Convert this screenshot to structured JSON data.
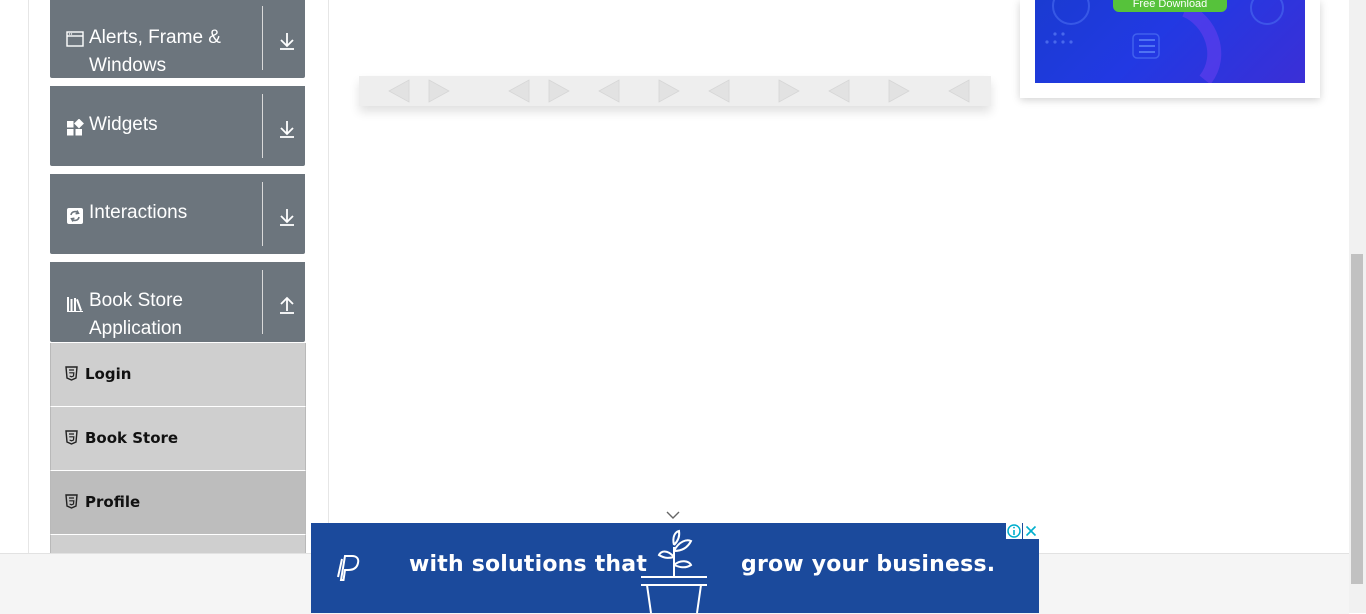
{
  "sidebar": {
    "groups": [
      {
        "title": "Alerts, Frame & Windows",
        "icon": "window-icon",
        "state": "collapsed"
      },
      {
        "title": "Widgets",
        "icon": "widgets-icon",
        "state": "collapsed"
      },
      {
        "title": "Interactions",
        "icon": "interactions-icon",
        "state": "collapsed"
      },
      {
        "title": "Book Store Application",
        "icon": "bookshelf-icon",
        "state": "expanded"
      }
    ],
    "book_store_items": [
      {
        "label": "Login",
        "icon": "html5-icon"
      },
      {
        "label": "Book Store",
        "icon": "html5-icon"
      },
      {
        "label": "Profile",
        "icon": "html5-icon",
        "active": true
      }
    ]
  },
  "top_ad": {
    "button_label": "Free Download"
  },
  "bottom_ad": {
    "text_left": "with solutions that",
    "text_right": "grow your business.",
    "brand_icon": "paypal-icon"
  },
  "colors": {
    "group_bg": "#6c757d",
    "item_bg": "#cfcfcf",
    "item_active_bg": "#bdbdbd",
    "ad_blue": "#1b4a9c"
  }
}
